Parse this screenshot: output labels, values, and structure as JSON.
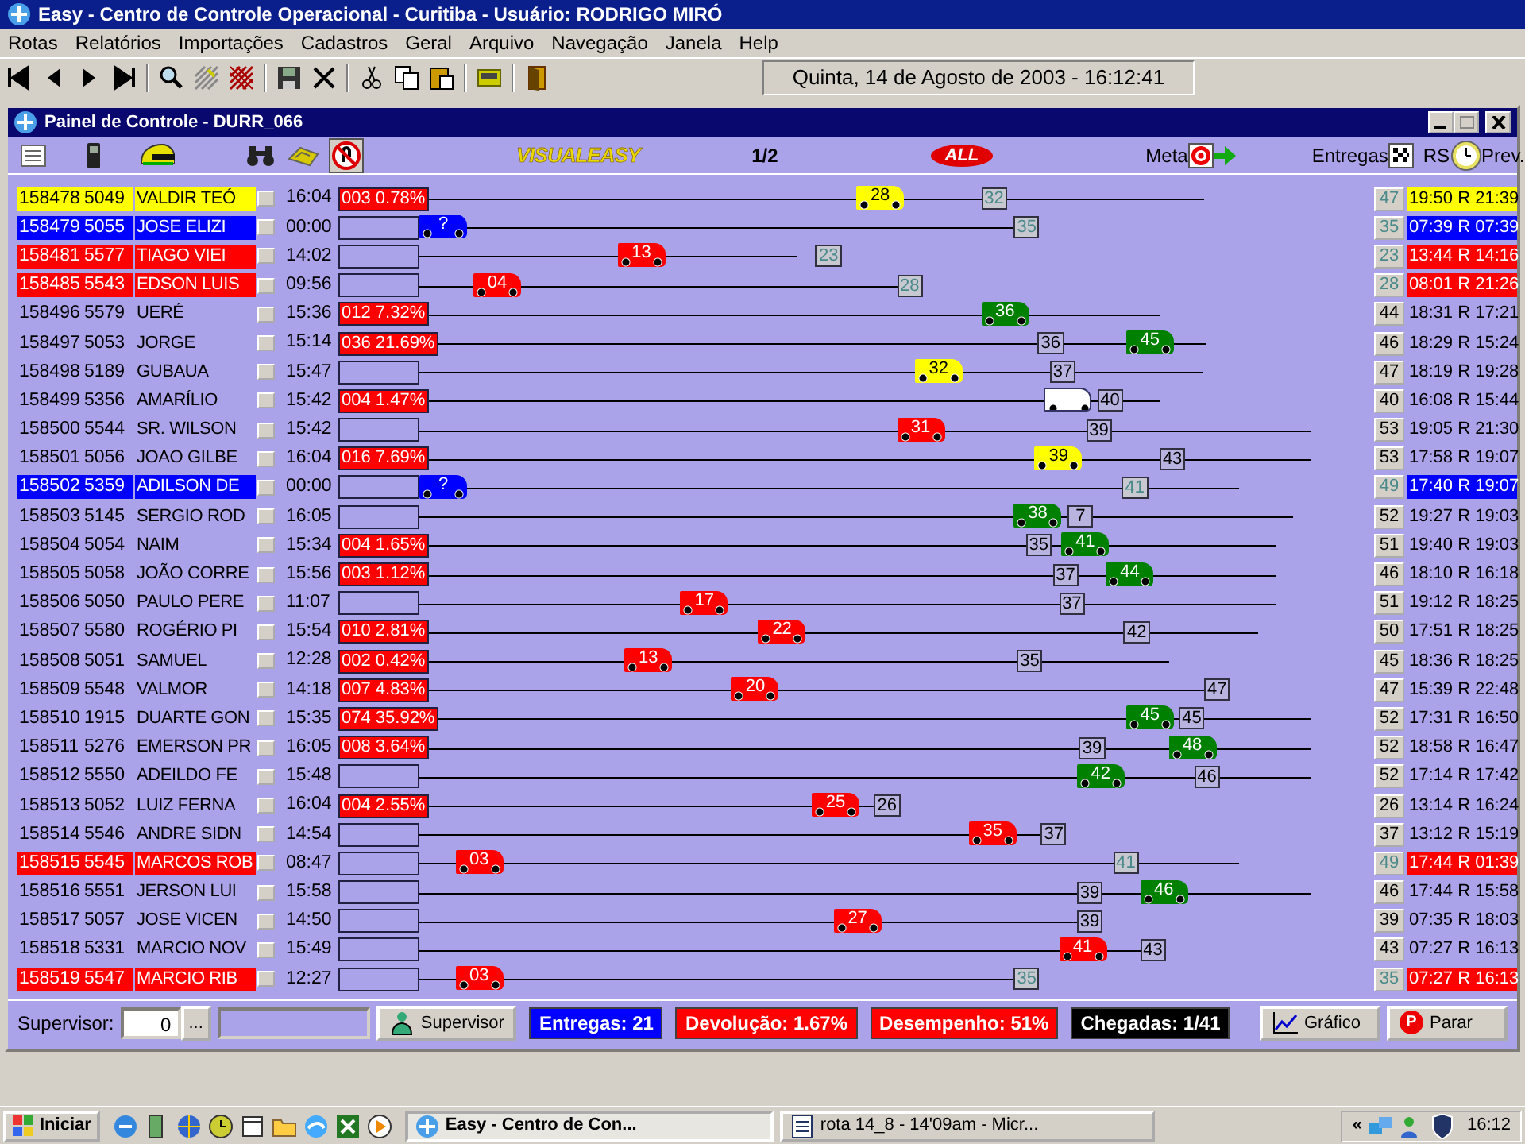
{
  "app": {
    "title": "Easy - Centro de Controle Operacional - Curitiba - Usuário: RODRIGO MIRÓ"
  },
  "menu": [
    "Rotas",
    "Relatórios",
    "Importações",
    "Cadastros",
    "Geral",
    "Arquivo",
    "Navegação",
    "Janela",
    "Help"
  ],
  "toolbar": {
    "date": "Quinta, 14 de Agosto de 2003 - 16:12:41"
  },
  "panel": {
    "title": "Painel de Controle  -  DURR_066",
    "brand_logo": "VISUALEASY",
    "page": "1/2",
    "carrier_logo": "ALL",
    "meta_label": "Meta",
    "deliveries_label": "Entregas",
    "rs_label": "RS",
    "prev_label": "Prev."
  },
  "rows": [
    {
      "id": "158478",
      "code": "5049",
      "name": "VALDIR TEÓ",
      "time": "16:04",
      "devolution": "003 0.78%",
      "color": "#ffff00",
      "route": {
        "level": 0.87
      },
      "truck": {
        "label": "28",
        "color": "#ffff00",
        "level": 0.48
      },
      "target": {
        "label": "32",
        "level": 0.62
      },
      "stop": "47",
      "forecast": "19:50 R 21:39"
    },
    {
      "id": "158479",
      "code": "5055",
      "name": "JOSE ELIZI",
      "time": "00:00",
      "color": "#0000ff",
      "route": {
        "level": 0.66
      },
      "truck": {
        "label": "?",
        "color": "#0000ff",
        "level": 0
      },
      "target": {
        "label": "35",
        "level": 0.66
      },
      "stop": "35",
      "forecast": "07:39 R 07:39"
    },
    {
      "id": "158481",
      "code": "5577",
      "name": "TIAGO VIEI",
      "time": "14:02",
      "color": "#ff0000",
      "route": {
        "level": 0.42
      },
      "truck": {
        "label": "13",
        "color": "#ff0000",
        "level": 0.22
      },
      "target": {
        "label": "23",
        "level": 0.44
      },
      "stop": "23",
      "forecast": "13:44 R 14:16"
    },
    {
      "id": "158485",
      "code": "5543",
      "name": "EDSON LUIS",
      "time": "09:56",
      "color": "#ff0000",
      "route": {
        "level": 0.53
      },
      "truck": {
        "label": "04",
        "color": "#ff0000",
        "level": 0.06
      },
      "target": {
        "label": "28",
        "level": 0.53
      },
      "stop": "28",
      "forecast": "08:01 R 21:26"
    },
    {
      "id": "158496",
      "code": "5579",
      "name": "UERÉ",
      "time": "15:36",
      "devolution": "012 7.32%",
      "route": {
        "level": 0.82
      },
      "truck": {
        "label": "36",
        "color": "#008000",
        "level": 0.62
      },
      "stop": "44",
      "forecast": "18:31 R 17:21"
    },
    {
      "id": "158497",
      "code": "5053",
      "name": "JORGE",
      "time": "15:14",
      "devolution": "036 21.69%",
      "route": {
        "level": 0.87
      },
      "truck": {
        "label": "45",
        "color": "#008000",
        "level": 0.78
      },
      "target": {
        "label": "36",
        "level": 0.68
      },
      "stop": "46",
      "forecast": "18:29 R 15:24"
    },
    {
      "id": "158498",
      "code": "5189",
      "name": "GUBAUA",
      "time": "15:47",
      "route": {
        "level": 0.87
      },
      "truck": {
        "label": "32",
        "color": "#ffff00",
        "level": 0.55
      },
      "target": {
        "label": "37",
        "level": 0.7
      },
      "stop": "47",
      "forecast": "18:19 R 19:28"
    },
    {
      "id": "158499",
      "code": "5356",
      "name": "AMARÍLIO",
      "time": "15:42",
      "devolution": "004 1.47%",
      "route": {
        "level": 0.82
      },
      "truck": {
        "color": "#ffffff",
        "level": 0.69
      },
      "target": {
        "label": "40",
        "level": 0.75
      },
      "stop": "40",
      "forecast": "16:08 R 15:44"
    },
    {
      "id": "158500",
      "code": "5544",
      "name": "SR. WILSON",
      "time": "15:42",
      "route": {
        "level": 0.99
      },
      "truck": {
        "label": "31",
        "color": "#ff0000",
        "level": 0.53
      },
      "target": {
        "label": "39",
        "level": 0.74
      },
      "stop": "53",
      "forecast": "19:05 R 21:30"
    },
    {
      "id": "158501",
      "code": "5056",
      "name": "JOAO GILBE",
      "time": "16:04",
      "devolution": "016 7.69%",
      "route": {
        "level": 0.99
      },
      "truck": {
        "label": "39",
        "color": "#ffff00",
        "level": 0.68
      },
      "target": {
        "label": "43",
        "level": 0.82
      },
      "stop": "53",
      "forecast": "17:58 R 19:07"
    },
    {
      "id": "158502",
      "code": "5359",
      "name": "ADILSON DE",
      "time": "00:00",
      "color": "#0000ff",
      "route": {
        "level": 0.91
      },
      "truck": {
        "label": "?",
        "color": "#0000ff",
        "level": 0
      },
      "target": {
        "label": "41",
        "level": 0.78
      },
      "stop": "49",
      "forecast": "17:40 R 19:07"
    },
    {
      "id": "158503",
      "code": "5145",
      "name": "SERGIO ROD",
      "time": "16:05",
      "route": {
        "level": 0.97
      },
      "truck": {
        "label": "38",
        "color": "#008000",
        "level": 0.66
      },
      "target": {
        "label": "7",
        "level": 0.72
      },
      "stop": "52",
      "forecast": "19:27 R 19:03"
    },
    {
      "id": "158504",
      "code": "5054",
      "name": "NAIM",
      "time": "15:34",
      "devolution": "004 1.65%",
      "route": {
        "level": 0.95
      },
      "truck": {
        "label": "41",
        "color": "#008000",
        "level": 0.71
      },
      "target": {
        "label": "35",
        "level": 0.67
      },
      "stop": "51",
      "forecast": "19:40 R 19:03"
    },
    {
      "id": "158505",
      "code": "5058",
      "name": "JOÃO CORRE",
      "time": "15:56",
      "devolution": "003 1.12%",
      "route": {
        "level": 0.95
      },
      "truck": {
        "label": "44",
        "color": "#008000",
        "level": 0.76
      },
      "target": {
        "label": "37",
        "level": 0.7
      },
      "stop": "46",
      "forecast": "18:10 R 16:18"
    },
    {
      "id": "158506",
      "code": "5050",
      "name": "PAULO PERE",
      "time": "11:07",
      "route": {
        "level": 0.95
      },
      "truck": {
        "label": "17",
        "color": "#ff0000",
        "level": 0.29
      },
      "target": {
        "label": "37",
        "level": 0.71
      },
      "stop": "51",
      "forecast": "19:12 R 18:25"
    },
    {
      "id": "158507",
      "code": "5580",
      "name": "ROGÉRIO PI",
      "time": "15:54",
      "devolution": "010 2.81%",
      "route": {
        "level": 0.93
      },
      "truck": {
        "label": "22",
        "color": "#ff0000",
        "level": 0.37
      },
      "target": {
        "label": "42",
        "level": 0.78
      },
      "stop": "50",
      "forecast": "17:51 R 18:25"
    },
    {
      "id": "158508",
      "code": "5051",
      "name": "SAMUEL",
      "time": "12:28",
      "devolution": "002 0.42%",
      "route": {
        "level": 0.83
      },
      "truck": {
        "label": "13",
        "color": "#ff0000",
        "level": 0.22
      },
      "target": {
        "label": "35",
        "level": 0.66
      },
      "stop": "45",
      "forecast": "18:36 R 18:25"
    },
    {
      "id": "158509",
      "code": "5548",
      "name": "VALMOR",
      "time": "14:18",
      "devolution": "007 4.83%",
      "route": {
        "level": 0.89
      },
      "truck": {
        "label": "20",
        "color": "#ff0000",
        "level": 0.34
      },
      "target": {
        "label": "47",
        "level": 0.87
      },
      "stop": "47",
      "forecast": "15:39 R 22:48"
    },
    {
      "id": "158510",
      "code": "1915",
      "name": "DUARTE GON",
      "time": "15:35",
      "devolution": "074 35.92%",
      "route": {
        "level": 0.99
      },
      "truck": {
        "label": "45",
        "color": "#008000",
        "level": 0.78
      },
      "target": {
        "label": "45",
        "level": 0.84
      },
      "stop": "52",
      "forecast": "17:31 R 16:50"
    },
    {
      "id": "158511",
      "code": "5276",
      "name": "EMERSON PR",
      "time": "16:05",
      "devolution": "008 3.64%",
      "route": {
        "level": 0.99
      },
      "truck": {
        "label": "48",
        "color": "#008000",
        "level": 0.83
      },
      "target": {
        "label": "39",
        "level": 0.73
      },
      "stop": "52",
      "forecast": "18:58 R 16:47"
    },
    {
      "id": "158512",
      "code": "5550",
      "name": "ADEILDO FE",
      "time": "15:48",
      "route": {
        "level": 0.99
      },
      "truck": {
        "label": "42",
        "color": "#008000",
        "level": 0.73
      },
      "target": {
        "label": "46",
        "level": 0.86
      },
      "stop": "52",
      "forecast": "17:14 R 17:42"
    },
    {
      "id": "158513",
      "code": "5052",
      "name": "LUIZ FERNA",
      "time": "16:04",
      "devolution": "004 2.55%",
      "route": {
        "level": 0.5
      },
      "truck": {
        "label": "25",
        "color": "#ff0000",
        "level": 0.43
      },
      "target": {
        "label": "26",
        "level": 0.5
      },
      "stop": "26",
      "forecast": "13:14 R 16:24"
    },
    {
      "id": "158514",
      "code": "5546",
      "name": "ANDRE SIDN",
      "time": "14:54",
      "route": {
        "level": 0.69
      },
      "truck": {
        "label": "35",
        "color": "#ff0000",
        "level": 0.61
      },
      "target": {
        "label": "37",
        "level": 0.69
      },
      "stop": "37",
      "forecast": "13:12 R 15:19"
    },
    {
      "id": "158515",
      "code": "5545",
      "name": "MARCOS ROB",
      "time": "08:47",
      "color": "#ff0000",
      "route": {
        "level": 0.91
      },
      "truck": {
        "label": "03",
        "color": "#ff0000",
        "level": 0.04
      },
      "target": {
        "label": "41",
        "level": 0.77
      },
      "stop": "49",
      "forecast": "17:44 R 01:39"
    },
    {
      "id": "158516",
      "code": "5551",
      "name": "JERSON LUI",
      "time": "15:58",
      "route": {
        "level": 0.99
      },
      "truck": {
        "label": "46",
        "color": "#008000",
        "level": 0.8
      },
      "target": {
        "label": "39",
        "level": 0.73
      },
      "stop": "46",
      "forecast": "17:44 R 15:58"
    },
    {
      "id": "158517",
      "code": "5057",
      "name": "JOSE VICEN",
      "time": "14:50",
      "route": {
        "level": 0.73
      },
      "truck": {
        "label": "27",
        "color": "#ff0000",
        "level": 0.46
      },
      "target": {
        "label": "39",
        "level": 0.73
      },
      "stop": "39",
      "forecast": "07:35 R 18:03"
    },
    {
      "id": "158518",
      "code": "5331",
      "name": "MARCIO NOV",
      "time": "15:49",
      "route": {
        "level": 0.8
      },
      "truck": {
        "label": "41",
        "color": "#ff0000",
        "level": 0.71
      },
      "target": {
        "label": "43",
        "level": 0.8
      },
      "stop": "43",
      "forecast": "07:27 R 16:13"
    },
    {
      "id": "158519",
      "code": "5547",
      "name": "MARCIO RIB",
      "time": "12:27",
      "color": "#ff0000",
      "route": {
        "level": 0.66
      },
      "truck": {
        "label": "03",
        "color": "#ff0000",
        "level": 0.04
      },
      "target": {
        "label": "35",
        "level": 0.66
      },
      "stop": "35",
      "forecast": "07:27 R 16:13"
    }
  ],
  "footer": {
    "supervisor_label": "Supervisor:",
    "supervisor_value": "0",
    "browse_button": "...",
    "supervisor_button": "Supervisor",
    "stats": [
      {
        "text": "Entregas: 21",
        "color": "#0000ff"
      },
      {
        "text": "Devolução: 1.67%",
        "color": "#ff0000"
      },
      {
        "text": "Desempenho: 51%",
        "color": "#ff0000"
      },
      {
        "text": "Chegadas: 1/41",
        "color": "#000000"
      }
    ],
    "chart_button": "Gráfico",
    "stop_icon_letter": "P",
    "stop_button": "Parar"
  },
  "taskbar": {
    "start": "Iniciar",
    "tasks": [
      {
        "label": "Easy - Centro de Con...",
        "selected": true
      },
      {
        "label": "rota 14_8 - 14'09am - Micr...",
        "selected": false
      }
    ],
    "tray_expand": "«",
    "clock": "16:12"
  }
}
